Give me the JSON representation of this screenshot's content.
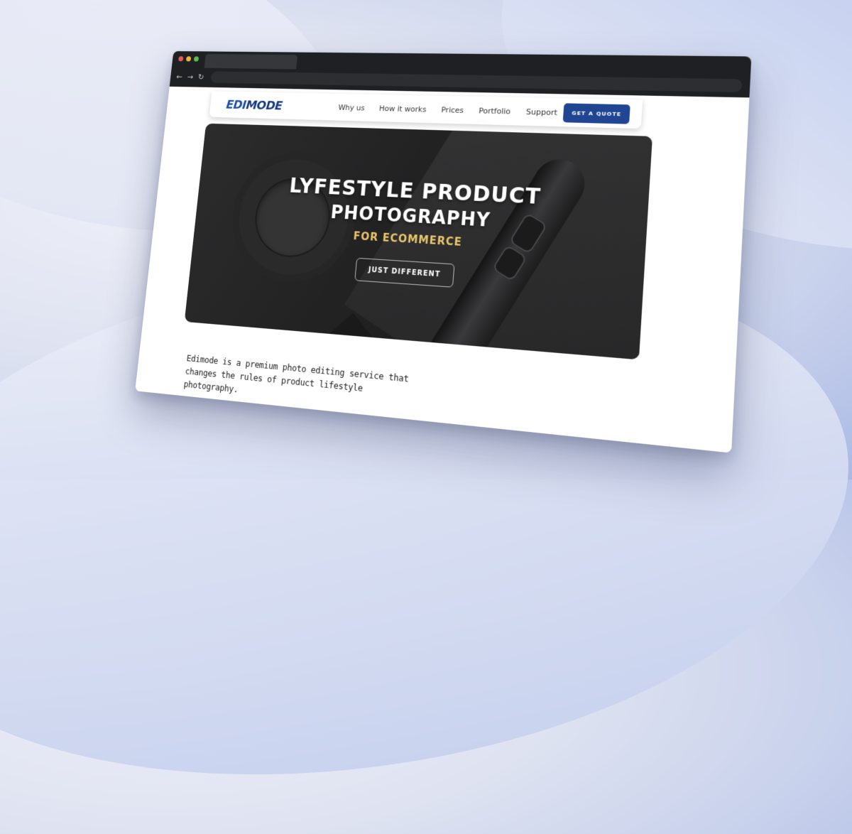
{
  "browser": {
    "controls": [
      "←",
      "→",
      "↻"
    ]
  },
  "site": {
    "logo": {
      "part1": "EDI",
      "part2": "MODE"
    },
    "nav": [
      "Why us",
      "How it works",
      "Prices",
      "Portfolio",
      "Support"
    ],
    "cta": "GET A QUOTE"
  },
  "hero": {
    "title_line1": "LYFESTYLE PRODUCT",
    "title_line2": "PHOTOGRAPHY",
    "subtitle": "FOR ECOMMERCE",
    "button": "JUST DIFFERENT"
  },
  "intro": "Edimode is a premium photo editing service that changes the rules of product lifestyle photography.",
  "colors": {
    "brand": "#1f4593",
    "accent": "#e8c66d",
    "hero_bg": "#222223"
  }
}
